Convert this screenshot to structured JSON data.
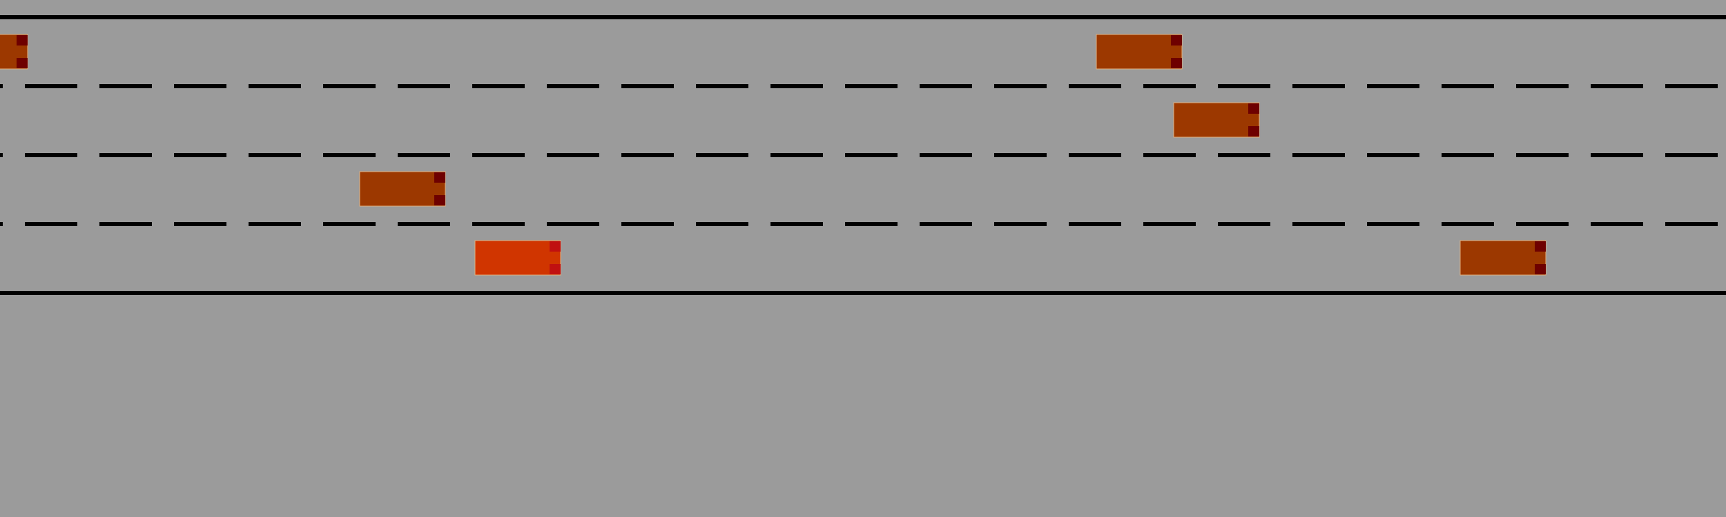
{
  "scene": {
    "type": "highway-driving",
    "lane_count": 4,
    "road_color": "#9b9b9b",
    "line_color": "#000000"
  },
  "colors": {
    "ego_body": "#d03500",
    "other_body": "#9c3800",
    "ego_light": "#c01010",
    "other_light": "#6e0000",
    "outline": "#e0b080"
  },
  "vehicles": [
    {
      "id": "car-1",
      "role": "other",
      "lane": 1
    },
    {
      "id": "car-2",
      "role": "other",
      "lane": 1
    },
    {
      "id": "car-3",
      "role": "other",
      "lane": 2
    },
    {
      "id": "car-4",
      "role": "other",
      "lane": 3
    },
    {
      "id": "ego",
      "role": "ego",
      "lane": 4
    },
    {
      "id": "car-5",
      "role": "other",
      "lane": 4
    }
  ]
}
